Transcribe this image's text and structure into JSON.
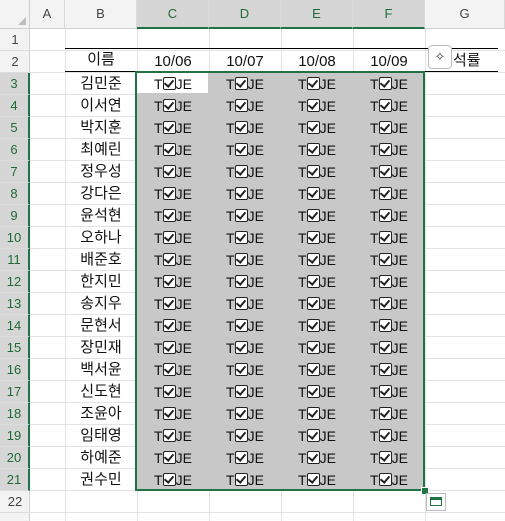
{
  "columns": [
    "A",
    "B",
    "C",
    "D",
    "E",
    "F",
    "G"
  ],
  "rows": [
    "1",
    "2",
    "3",
    "4",
    "5",
    "6",
    "7",
    "8",
    "9",
    "10",
    "11",
    "12",
    "13",
    "14",
    "15",
    "16",
    "17",
    "18",
    "19",
    "20",
    "21",
    "22"
  ],
  "header_name_label": "이름",
  "dates": [
    "10/06",
    "10/07",
    "10/08",
    "10/09"
  ],
  "names": [
    "김민준",
    "이서연",
    "박지훈",
    "최예린",
    "정우성",
    "강다은",
    "윤석현",
    "오하나",
    "배준호",
    "한지민",
    "송지우",
    "문현서",
    "장민재",
    "백서윤",
    "신도현",
    "조윤아",
    "임태영",
    "하예준",
    "권수민"
  ],
  "cell_value_left": "T",
  "cell_value_right": "JE",
  "analyze_label": "석률",
  "colors": {
    "accent": "#217346",
    "selection_fill": "#c8c8c8",
    "header_bg": "#f3f3f3"
  },
  "icons": {
    "checkbox": "checkbox-checked-icon",
    "analyze": "sparkle-icon",
    "quick_analysis": "quick-analysis-icon"
  }
}
